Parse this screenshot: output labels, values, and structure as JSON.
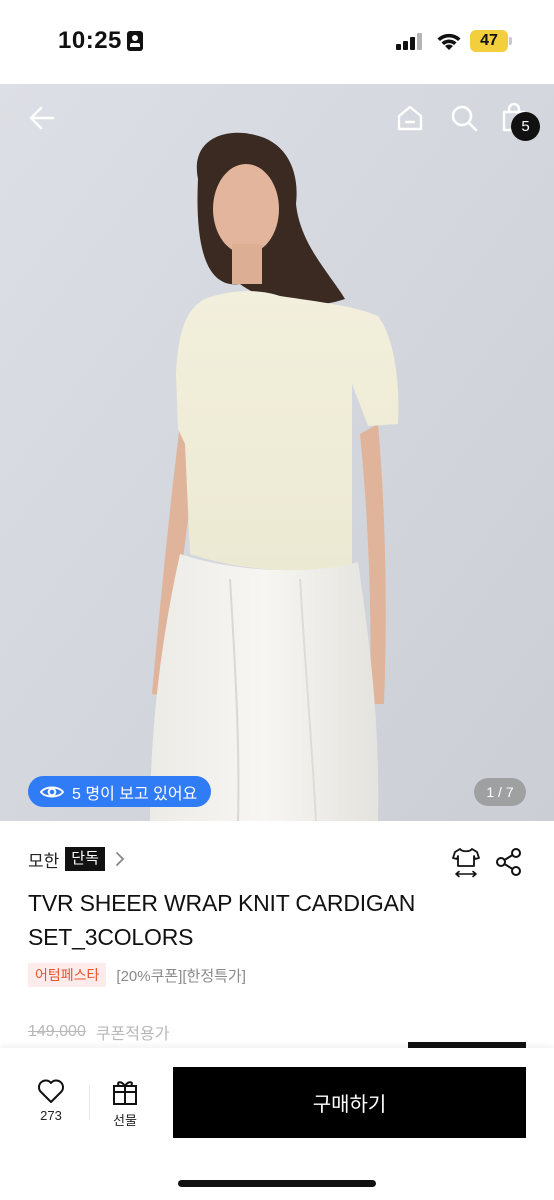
{
  "status_bar": {
    "time": "10:25",
    "battery": "47",
    "icons": [
      "id-card-icon",
      "signal-icon",
      "wifi-icon",
      "battery-icon"
    ]
  },
  "header": {
    "icons": [
      "back-arrow-icon",
      "home-icon",
      "search-icon",
      "cart-icon"
    ],
    "cart_count": "5"
  },
  "gallery": {
    "viewers_text": "5 명이 보고 있어요",
    "page_indicator": "1 / 7",
    "viewers_icon": "eye-icon"
  },
  "product": {
    "brand": "모한",
    "brand_tag": "단독",
    "title": "TVR SHEER WRAP KNIT CARDIGAN SET_3COLORS",
    "event_badge": "어텀페스타",
    "coupon_text": "[20%쿠폰][한정특가]",
    "original_price": "149,000",
    "coupon_price_label": "쿠폰적용가",
    "action_icons": [
      "size-guide-icon",
      "share-icon"
    ]
  },
  "bottom_bar": {
    "like_count": "273",
    "gift_label": "선물",
    "buy_label": "구매하기"
  },
  "colors": {
    "accent_blue": "#2f7cf6",
    "event_orange": "#e8542c",
    "event_bg": "#fdeceb",
    "battery_yellow": "#f4cf3d"
  }
}
